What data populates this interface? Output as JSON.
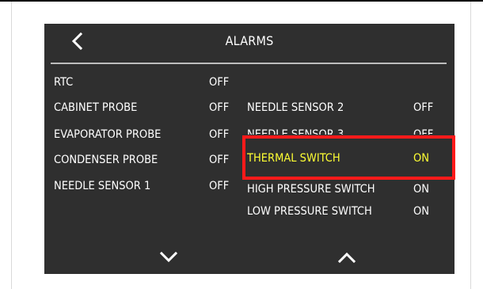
{
  "screen": {
    "title": "ALARMS",
    "icons": {
      "back": "chevron-left-icon",
      "scroll_down": "chevron-down-icon",
      "scroll_up": "chevron-up-icon"
    },
    "left_column": [
      {
        "label": "RTC",
        "value": "OFF"
      },
      {
        "label": "CABINET PROBE",
        "value": "OFF"
      },
      {
        "label": "EVAPORATOR PROBE",
        "value": "OFF"
      },
      {
        "label": "CONDENSER PROBE",
        "value": "OFF"
      },
      {
        "label": "NEEDLE SENSOR 1",
        "value": "OFF"
      }
    ],
    "right_column": [
      {
        "label": "NEEDLE SENSOR 2",
        "value": "OFF"
      },
      {
        "label": "NEEDLE SENSOR 3",
        "value": "OFF"
      },
      {
        "label": "THERMAL SWITCH",
        "value": "ON"
      },
      {
        "label": "HIGH PRESSURE SWITCH",
        "value": "ON"
      },
      {
        "label": "LOW PRESSURE SWITCH",
        "value": "ON"
      }
    ]
  },
  "colors": {
    "screen_background": "#2f2f2f",
    "text": "#ffffff",
    "highlighted_text": "#ffff33",
    "annotation_box": "#ff1a1a"
  }
}
